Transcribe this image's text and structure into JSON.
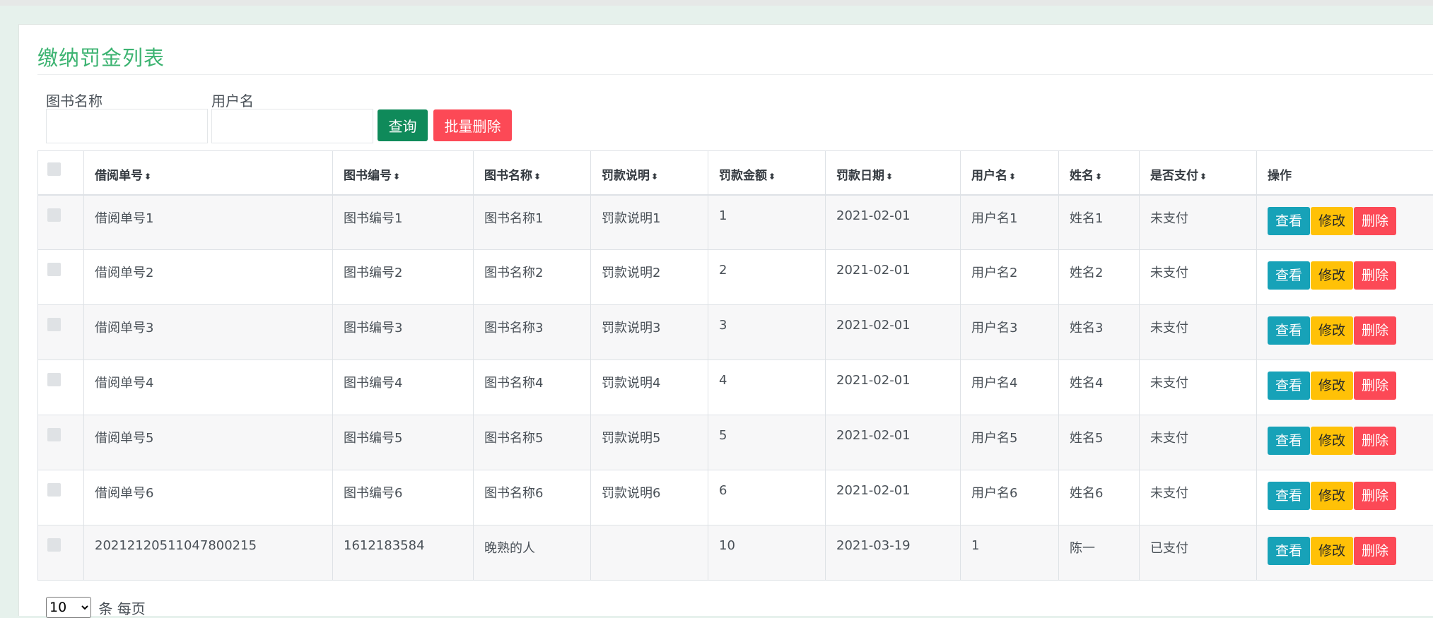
{
  "page_title": "缴纳罚金列表",
  "search": {
    "book_name_label": "图书名称",
    "book_name_value": "",
    "username_label": "用户名",
    "username_value": "",
    "query_label": "查询",
    "batch_delete_label": "批量删除"
  },
  "table": {
    "columns": [
      "借阅单号",
      "图书编号",
      "图书名称",
      "罚款说明",
      "罚款金额",
      "罚款日期",
      "用户名",
      "姓名",
      "是否支付",
      "操作"
    ],
    "sort_icon": "⬍",
    "rows": [
      [
        "借阅单号1",
        "图书编号1",
        "图书名称1",
        "罚款说明1",
        "1",
        "2021-02-01",
        "用户名1",
        "姓名1",
        "未支付"
      ],
      [
        "借阅单号2",
        "图书编号2",
        "图书名称2",
        "罚款说明2",
        "2",
        "2021-02-01",
        "用户名2",
        "姓名2",
        "未支付"
      ],
      [
        "借阅单号3",
        "图书编号3",
        "图书名称3",
        "罚款说明3",
        "3",
        "2021-02-01",
        "用户名3",
        "姓名3",
        "未支付"
      ],
      [
        "借阅单号4",
        "图书编号4",
        "图书名称4",
        "罚款说明4",
        "4",
        "2021-02-01",
        "用户名4",
        "姓名4",
        "未支付"
      ],
      [
        "借阅单号5",
        "图书编号5",
        "图书名称5",
        "罚款说明5",
        "5",
        "2021-02-01",
        "用户名5",
        "姓名5",
        "未支付"
      ],
      [
        "借阅单号6",
        "图书编号6",
        "图书名称6",
        "罚款说明6",
        "6",
        "2021-02-01",
        "用户名6",
        "姓名6",
        "未支付"
      ],
      [
        "20212120511047800215",
        "1612183584",
        "晚熟的人",
        "",
        "10",
        "2021-03-19",
        "1",
        "陈一",
        "已支付"
      ]
    ],
    "actions": {
      "view": "查看",
      "edit": "修改",
      "delete": "删除"
    }
  },
  "pagination": {
    "page_size": "10",
    "options": [
      "10"
    ],
    "suffix": "条 每页"
  },
  "colors": {
    "title": "#3cb371",
    "query_button": "#0f8a5a",
    "delete_button": "#fc4956",
    "view_button": "#17a2b8",
    "edit_button": "#ffc107"
  }
}
